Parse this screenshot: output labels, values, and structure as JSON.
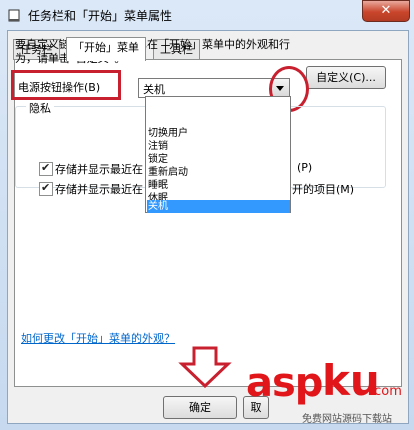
{
  "window": {
    "title": "任务栏和「开始」菜单属性",
    "close_label": "✕"
  },
  "tabs": [
    {
      "label": "任务栏"
    },
    {
      "label": "「开始」菜单"
    },
    {
      "label": "工具栏"
    }
  ],
  "start_menu": {
    "description": "要自定义链接、图标和菜单在「开始」菜单中的外观和行为，请单击“自定义”。",
    "customize_label": "自定义(C)...",
    "power_label": "电源按钮操作(B)",
    "power_selected": "关机",
    "power_options": [
      "切换用户",
      "注销",
      "锁定",
      "重新启动",
      "睡眠",
      "休眠",
      "关机"
    ],
    "privacy_title": "隐私",
    "privacy_1": "存储并显示最近在「开始」菜单中打开的程序(P)",
    "privacy_2": "存储并显示最近在「开始」菜单和任务栏中打开的项目(M)",
    "privacy_1_visible_tail": "(P)",
    "privacy_2_visible_tail": "开的项目(M)",
    "help_link": "如何更改「开始」菜单的外观？"
  },
  "buttons": {
    "ok": "确定",
    "cancel_partial": "取"
  },
  "watermark": {
    "brand": "asp",
    "brand2": "ku",
    "tld": ".com",
    "sub": "免费网站源码下载站"
  }
}
